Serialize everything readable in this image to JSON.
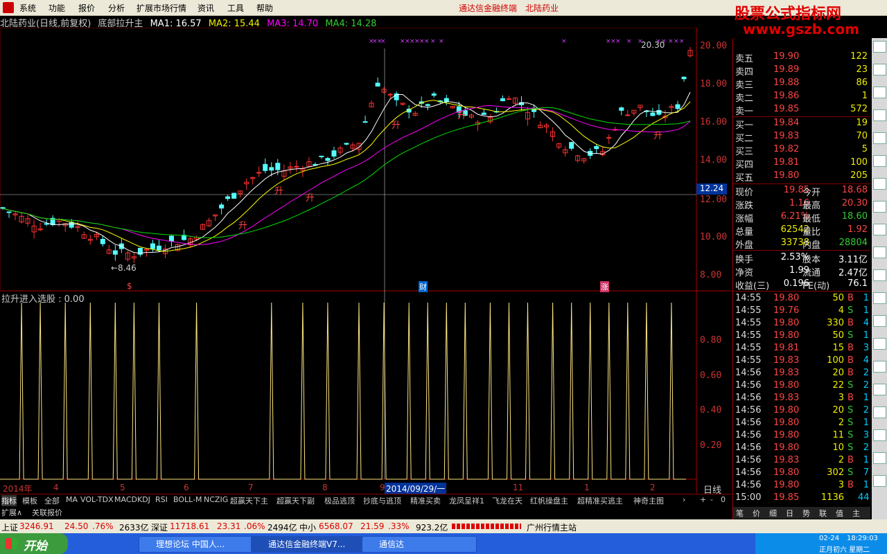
{
  "menu": {
    "items": [
      "系统",
      "功能",
      "报价",
      "分析",
      "扩展市场行情",
      "资讯",
      "工具",
      "帮助"
    ],
    "app_title": "通达信金融终端",
    "stock_title": "北陆药业"
  },
  "watermark": {
    "line1": "股票公式指标网",
    "line2": "www.gszb.com"
  },
  "chart_header": {
    "name": "北陆药业(日线,前复权)",
    "formula": "底部拉升主",
    "ma1": "MA1: 16.57",
    "ma2": "MA2: 15.44",
    "ma3": "MA3: 14.70",
    "ma4": "MA4: 14.28"
  },
  "price_axis": [
    "20.00",
    "18.00",
    "16.00",
    "14.00",
    "12.00",
    "10.00",
    "8.00"
  ],
  "crosshair_price": "12.24",
  "annotations": {
    "high": "20.30",
    "low": "←8.46",
    "sheng": "升",
    "cai": "财",
    "zhang": "涨",
    "s": "$"
  },
  "indicator": {
    "title": "拉升进入选股 : 0.00",
    "axis": [
      "0.80",
      "0.60",
      "0.40",
      "0.20"
    ]
  },
  "date_axis": {
    "labels": [
      "2014年",
      "4",
      "5",
      "6",
      "7",
      "8",
      "9",
      "10",
      "11",
      "12",
      "1",
      "2"
    ],
    "selected": "2014/09/29/一",
    "period": "日线"
  },
  "chart_data": {
    "type": "candlestick",
    "title": "北陆药业(日线,前复权)",
    "ylim": [
      7.5,
      20.5
    ],
    "ma": {
      "MA1": 16.57,
      "MA2": 15.44,
      "MA3": 14.7,
      "MA4": 14.28
    },
    "high_label": 20.3,
    "low_label": 8.46,
    "close_path": [
      [
        0,
        11.5
      ],
      [
        3,
        11.0
      ],
      [
        6,
        10.6
      ],
      [
        9,
        10.9
      ],
      [
        12,
        10.5
      ],
      [
        15,
        9.9
      ],
      [
        18,
        9.2
      ],
      [
        21,
        9.1
      ],
      [
        24,
        9.4
      ],
      [
        27,
        9.7
      ],
      [
        30,
        9.9
      ],
      [
        33,
        10.8
      ],
      [
        36,
        11.9
      ],
      [
        39,
        12.9
      ],
      [
        42,
        13.5
      ],
      [
        45,
        13.5
      ],
      [
        48,
        13.8
      ],
      [
        51,
        14.0
      ],
      [
        54,
        14.5
      ],
      [
        57,
        15.0
      ],
      [
        60,
        18.1
      ],
      [
        63,
        17.0
      ],
      [
        66,
        16.6
      ],
      [
        69,
        17.2
      ],
      [
        72,
        16.8
      ],
      [
        75,
        16.2
      ],
      [
        78,
        16.3
      ],
      [
        81,
        17.5
      ],
      [
        84,
        16.7
      ],
      [
        87,
        15.8
      ],
      [
        90,
        14.8
      ],
      [
        93,
        14.3
      ],
      [
        96,
        14.5
      ],
      [
        99,
        16.5
      ],
      [
        102,
        16.8
      ],
      [
        105,
        16.2
      ],
      [
        108,
        16.9
      ],
      [
        110,
        19.85
      ]
    ],
    "signal_positions": [
      3,
      6,
      10,
      14,
      18,
      21,
      25,
      31,
      43,
      48,
      52,
      57,
      61,
      65,
      68,
      71,
      74,
      78,
      81,
      84,
      88,
      91,
      94,
      97,
      100,
      103,
      107
    ]
  },
  "quote": {
    "sell": [
      {
        "label": "卖五",
        "price": "19.90",
        "vol": "122"
      },
      {
        "label": "卖四",
        "price": "19.89",
        "vol": "23"
      },
      {
        "label": "卖三",
        "price": "19.88",
        "vol": "86"
      },
      {
        "label": "卖二",
        "price": "19.86",
        "vol": "1"
      },
      {
        "label": "卖一",
        "price": "19.85",
        "vol": "572"
      }
    ],
    "buy": [
      {
        "label": "买一",
        "price": "19.84",
        "vol": "19"
      },
      {
        "label": "买二",
        "price": "19.83",
        "vol": "70"
      },
      {
        "label": "买三",
        "price": "19.82",
        "vol": "5"
      },
      {
        "label": "买四",
        "price": "19.81",
        "vol": "100"
      },
      {
        "label": "买五",
        "price": "19.80",
        "vol": "205"
      }
    ],
    "stats": [
      {
        "l1": "现价",
        "v1": "19.85",
        "l2": "今开",
        "v2": "18.68"
      },
      {
        "l1": "涨跌",
        "v1": "1.16",
        "l2": "最高",
        "v2": "20.30"
      },
      {
        "l1": "涨幅",
        "v1": "6.21%",
        "l2": "最低",
        "v2": "18.60"
      },
      {
        "l1": "总量",
        "v1": "62542",
        "l2": "量比",
        "v2": "1.92"
      },
      {
        "l1": "外盘",
        "v1": "33738",
        "l2": "内盘",
        "v2": "28804"
      }
    ],
    "stats2": [
      {
        "l1": "换手",
        "v1": "2.53%",
        "l2": "股本",
        "v2": "3.11亿"
      },
      {
        "l1": "净资",
        "v1": "1.99",
        "l2": "流通",
        "v2": "2.47亿"
      },
      {
        "l1": "收益(三)",
        "v1": "0.196",
        "l2": "PE(动)",
        "v2": "76.1"
      }
    ],
    "ticks": [
      {
        "t": "14:55",
        "p": "19.80",
        "v": "50",
        "d": "B",
        "n": "1"
      },
      {
        "t": "14:55",
        "p": "19.76",
        "v": "4",
        "d": "S",
        "n": "1"
      },
      {
        "t": "14:55",
        "p": "19.80",
        "v": "330",
        "d": "B",
        "n": "4"
      },
      {
        "t": "14:55",
        "p": "19.80",
        "v": "50",
        "d": "S",
        "n": "1"
      },
      {
        "t": "14:55",
        "p": "19.81",
        "v": "15",
        "d": "B",
        "n": "3"
      },
      {
        "t": "14:55",
        "p": "19.83",
        "v": "100",
        "d": "B",
        "n": "4"
      },
      {
        "t": "14:56",
        "p": "19.83",
        "v": "20",
        "d": "B",
        "n": "2"
      },
      {
        "t": "14:56",
        "p": "19.80",
        "v": "22",
        "d": "S",
        "n": "2"
      },
      {
        "t": "14:56",
        "p": "19.83",
        "v": "3",
        "d": "B",
        "n": "1"
      },
      {
        "t": "14:56",
        "p": "19.80",
        "v": "20",
        "d": "S",
        "n": "2"
      },
      {
        "t": "14:56",
        "p": "19.80",
        "v": "2",
        "d": "S",
        "n": "1"
      },
      {
        "t": "14:56",
        "p": "19.80",
        "v": "11",
        "d": "S",
        "n": "3"
      },
      {
        "t": "14:56",
        "p": "19.80",
        "v": "10",
        "d": "S",
        "n": "2"
      },
      {
        "t": "14:56",
        "p": "19.83",
        "v": "2",
        "d": "B",
        "n": "1"
      },
      {
        "t": "14:56",
        "p": "19.80",
        "v": "302",
        "d": "S",
        "n": "7"
      },
      {
        "t": "14:56",
        "p": "19.80",
        "v": "3",
        "d": "B",
        "n": "1"
      },
      {
        "t": "15:00",
        "p": "19.85",
        "v": "1136",
        "d": "",
        "n": "44"
      }
    ],
    "bottom_tabs": [
      "笔",
      "价",
      "细",
      "日",
      "势",
      "联",
      "值",
      "主"
    ]
  },
  "tabs": [
    "指标",
    "模板",
    "全部",
    "MA",
    "VOL-TDX",
    "MACD",
    "KDJ",
    "RSI",
    "BOLL-M",
    "NCZIG",
    "超赢天下主",
    "超赢天下副",
    "极品逃顶",
    "抄底与逃顶",
    "精准买卖",
    "龙凤呈祥1",
    "飞龙在天",
    "红帆操盘主",
    "超精准买逃主",
    "神奇主图"
  ],
  "subtabs": [
    "扩展∧",
    "关联报价"
  ],
  "status": {
    "sh_label": "上证",
    "sh_val": "3246.91",
    "sh_chg": "24.50",
    "sh_pct": ".76%",
    "sh_amt": "2633亿",
    "sz_label": "深证",
    "sz_val": "11718.61",
    "sz_chg": "23.31",
    "sz_pct": ".06%",
    "sz_amt": "2494亿",
    "zx_label": "中小",
    "zx_val": "6568.07",
    "zx_chg": "21.59",
    "zx_pct": ".33%",
    "zx_amt": "923.2亿",
    "server": "广州行情主站"
  },
  "taskbar": {
    "start": "开始",
    "tasks": [
      "理想论坛 中国人...",
      "通达信金融终端V7...",
      "通信达"
    ],
    "time": "18:29:03",
    "date": "02-24",
    "lunar": "正月初六 星期二"
  }
}
